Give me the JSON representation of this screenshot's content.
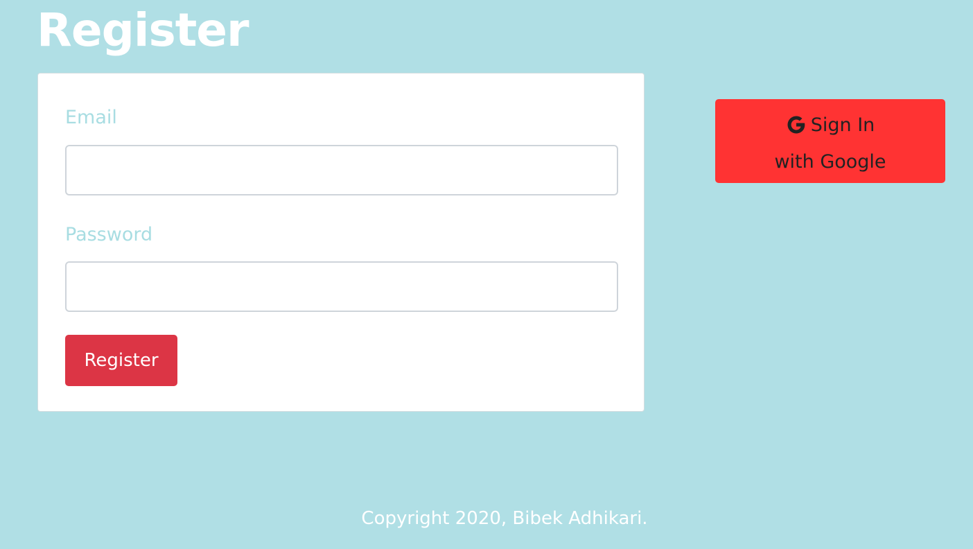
{
  "page": {
    "title": "Register",
    "background_color": "#b0dfe5"
  },
  "form": {
    "email_label": "Email",
    "email_value": "",
    "email_placeholder": "",
    "password_label": "Password",
    "password_value": "",
    "password_placeholder": "",
    "submit_label": "Register",
    "submit_color": "#dc3545"
  },
  "google": {
    "line1": "Sign In",
    "line2": "with Google",
    "icon": "google-g-icon",
    "color": "#ff3333"
  },
  "footer": {
    "text": "Copyright 2020, Bibek Adhikari."
  }
}
